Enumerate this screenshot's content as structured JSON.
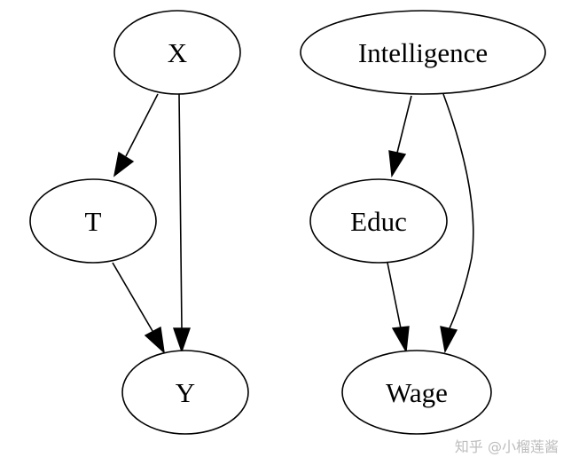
{
  "diagram": {
    "nodes": {
      "x": "X",
      "t": "T",
      "y": "Y",
      "intelligence": "Intelligence",
      "educ": "Educ",
      "wage": "Wage"
    },
    "edges": [
      {
        "from": "X",
        "to": "T"
      },
      {
        "from": "X",
        "to": "Y"
      },
      {
        "from": "T",
        "to": "Y"
      },
      {
        "from": "Intelligence",
        "to": "Educ"
      },
      {
        "from": "Intelligence",
        "to": "Wage"
      },
      {
        "from": "Educ",
        "to": "Wage"
      }
    ]
  },
  "watermark": "知乎 @小榴莲酱",
  "colors": {
    "stroke": "#000000",
    "background": "#ffffff",
    "watermark": "#bdbdbd"
  }
}
